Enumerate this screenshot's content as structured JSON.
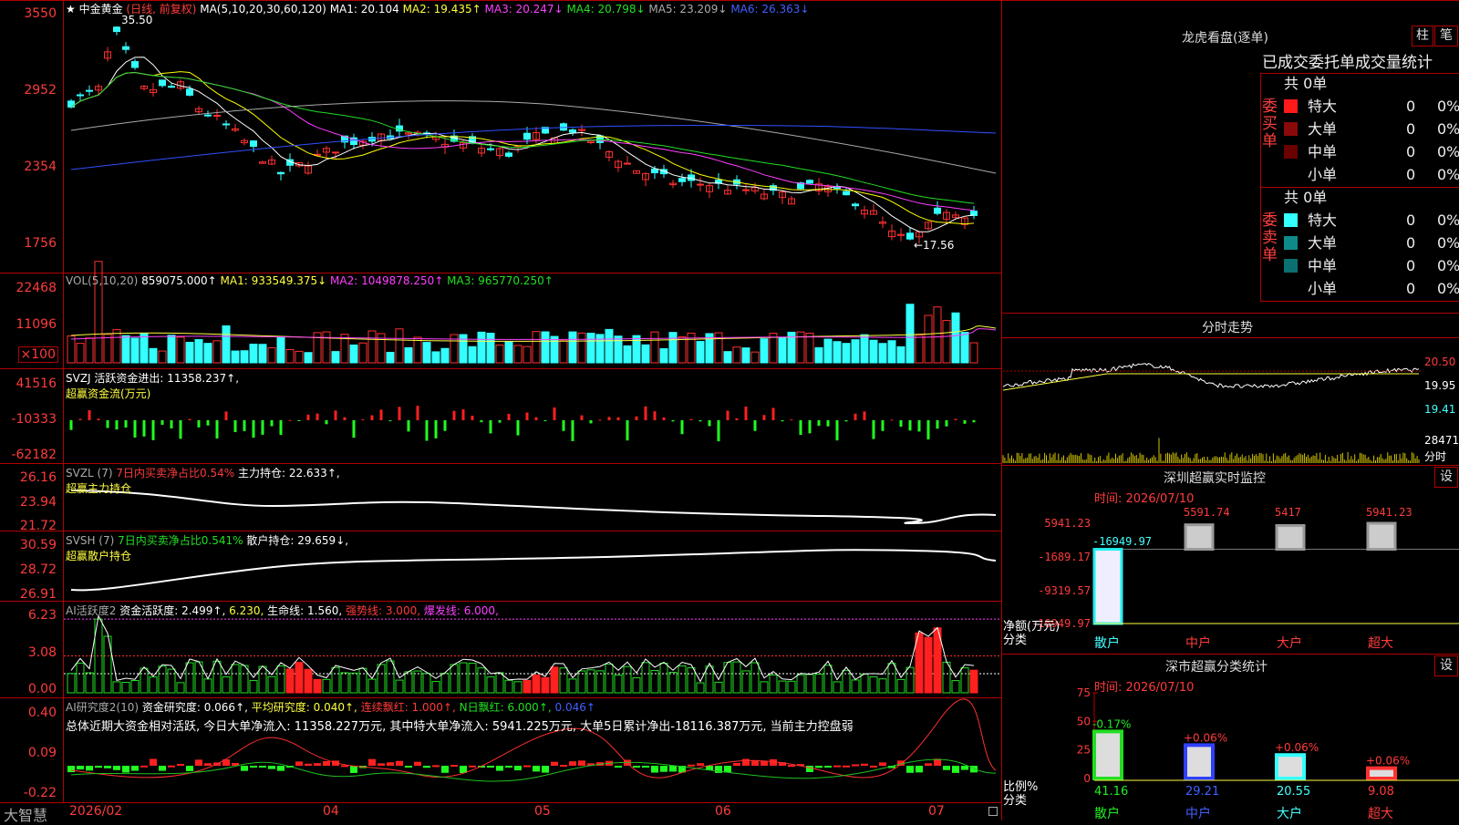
{
  "main": {
    "title": "★ 中金黄金",
    "mode": "(日线, 前复权)",
    "ma_label": "MA(5,10,20,30,60,120)",
    "ma1": "MA1: 20.104",
    "ma2": "MA2: 19.435↑",
    "ma3": "MA3: 20.247↓",
    "ma4": "MA4: 20.798↓",
    "ma5": "MA5: 23.209↓",
    "ma6": "MA6: 26.363↓",
    "yaxis": [
      "3550",
      "2952",
      "2354",
      "1756"
    ],
    "high_label": "35.50",
    "low_label": "←17.56"
  },
  "vol": {
    "label": "VOL(5,10,20)",
    "value": "859075.000↑",
    "ma1": "MA1: 933549.375↓",
    "ma2": "MA2: 1049878.250↑",
    "ma3": "MA3: 965770.250↑",
    "yaxis": [
      "22468",
      "11096"
    ],
    "unit": "×100"
  },
  "svzj": {
    "label": "SVZJ  活跃资金进出: 11358.237↑,",
    "sub": "超赢资金流(万元)",
    "yaxis": [
      "41516",
      "-10333",
      "-62182"
    ]
  },
  "svzl": {
    "name": "SVZL (7)",
    "ratio": "7日内买卖净占比0.54%",
    "hold": "主力持仓: 22.633↑,",
    "sub": "超赢主力持仓",
    "yaxis": [
      "26.16",
      "23.94",
      "21.72"
    ]
  },
  "svsh": {
    "name": "SVSH (7)",
    "ratio": "7日内买卖净占比0.541%",
    "hold": "散户持仓: 29.659↓,",
    "sub": "超赢散户持仓",
    "yaxis": [
      "30.59",
      "28.72",
      "26.91"
    ]
  },
  "ai_active": {
    "name": "AI活跃度2",
    "active": "资金活跃度: 2.499↑,",
    "val2": "6.230,",
    "life": "生命线: 1.560,",
    "strong": "强势线: 3.000,",
    "burst": "爆发线: 6.000,",
    "yaxis": [
      "6.23",
      "3.08",
      "0.00"
    ]
  },
  "ai_research": {
    "name": "AI研究度2(10)",
    "research": "资金研究度: 0.066↑,",
    "avg": "平均研究度: 0.040↑,",
    "streak": "连续飘红: 1.000↑,",
    "nday": "N日飘红: 6.000↑,",
    "last": "0.046↑",
    "summary": "总体近期大资金相对活跃, 今日大单净流入: 11358.227万元, 其中特大单净流入: 5941.225万元, 大单5日累计净出-18116.387万元, 当前主力控盘弱",
    "yaxis": [
      "0.40",
      "0.09",
      "-0.22"
    ]
  },
  "xaxis": {
    "brand": "大智慧",
    "labels": [
      "2026/02",
      "04",
      "05",
      "06",
      "07"
    ]
  },
  "right": {
    "dragon_title": "龙虎看盘(逐单)",
    "btn_bar": "柱",
    "btn_note": "笔",
    "stats_title": "已成交委托单成交量统计",
    "buy_group": "委买单",
    "sell_group": "委卖单",
    "buy_total": "共 0单",
    "sell_total": "共 0单",
    "buy_rows": [
      {
        "name": "特大",
        "count": "0",
        "pct": "0%",
        "color": "#ff1a1a"
      },
      {
        "name": "大单",
        "count": "0",
        "pct": "0%",
        "color": "#8a0a0a"
      },
      {
        "name": "中单",
        "count": "0",
        "pct": "0%",
        "color": "#6a0000"
      },
      {
        "name": "小单",
        "count": "0",
        "pct": "0%",
        "color": "#000000"
      }
    ],
    "sell_rows": [
      {
        "name": "特大",
        "count": "0",
        "pct": "0%",
        "color": "#33ffff"
      },
      {
        "name": "大单",
        "count": "0",
        "pct": "0%",
        "color": "#0f8a8a"
      },
      {
        "name": "中单",
        "count": "0",
        "pct": "0%",
        "color": "#0a7070"
      },
      {
        "name": "小单",
        "count": "0",
        "pct": "0%",
        "color": "#000000"
      }
    ],
    "intraday_title": "分时走势",
    "intraday_yaxis": [
      "20.50",
      "19.95",
      "19.41"
    ],
    "intraday_vol": "28471",
    "intraday_vol_label": "分时",
    "sz_title": "深圳超赢实时监控",
    "sz_set": "设",
    "sz_time": "时间: 2026/07/10",
    "sz_yaxis": [
      "5941.23",
      "-1689.17",
      "-9319.57",
      "-16949.97"
    ],
    "sz_bar_labels": [
      "-16949.97",
      "5591.74",
      "5417",
      "5941.23"
    ],
    "sz_ylabel": "净额(万元)",
    "sz_xlabel": "分类",
    "sz_cats": [
      "散户",
      "中户",
      "大户",
      "超大"
    ],
    "cls_title": "深市超赢分类统计",
    "cls_set": "设",
    "cls_time": "时间: 2026/07/10",
    "cls_yaxis": [
      "75",
      "50",
      "25",
      "0"
    ],
    "cls_pcts": [
      "-0.17%",
      "+0.06%",
      "+0.06%",
      "+0.06%"
    ],
    "cls_vals": [
      "41.16",
      "29.21",
      "20.55",
      "9.08"
    ],
    "cls_ylabel": "比例%",
    "cls_xlabel": "分类",
    "cls_cats": [
      "散户",
      "中户",
      "大户",
      "超大"
    ]
  },
  "colors": {
    "up": "#ff3030",
    "down": "#33ffff",
    "grid": "#b00000",
    "ma1": "#ffffff",
    "ma2": "#ffff00",
    "ma3": "#ff40ff",
    "ma4": "#22dd22",
    "ma5": "#aaaaaa",
    "ma6": "#3050ff"
  }
}
